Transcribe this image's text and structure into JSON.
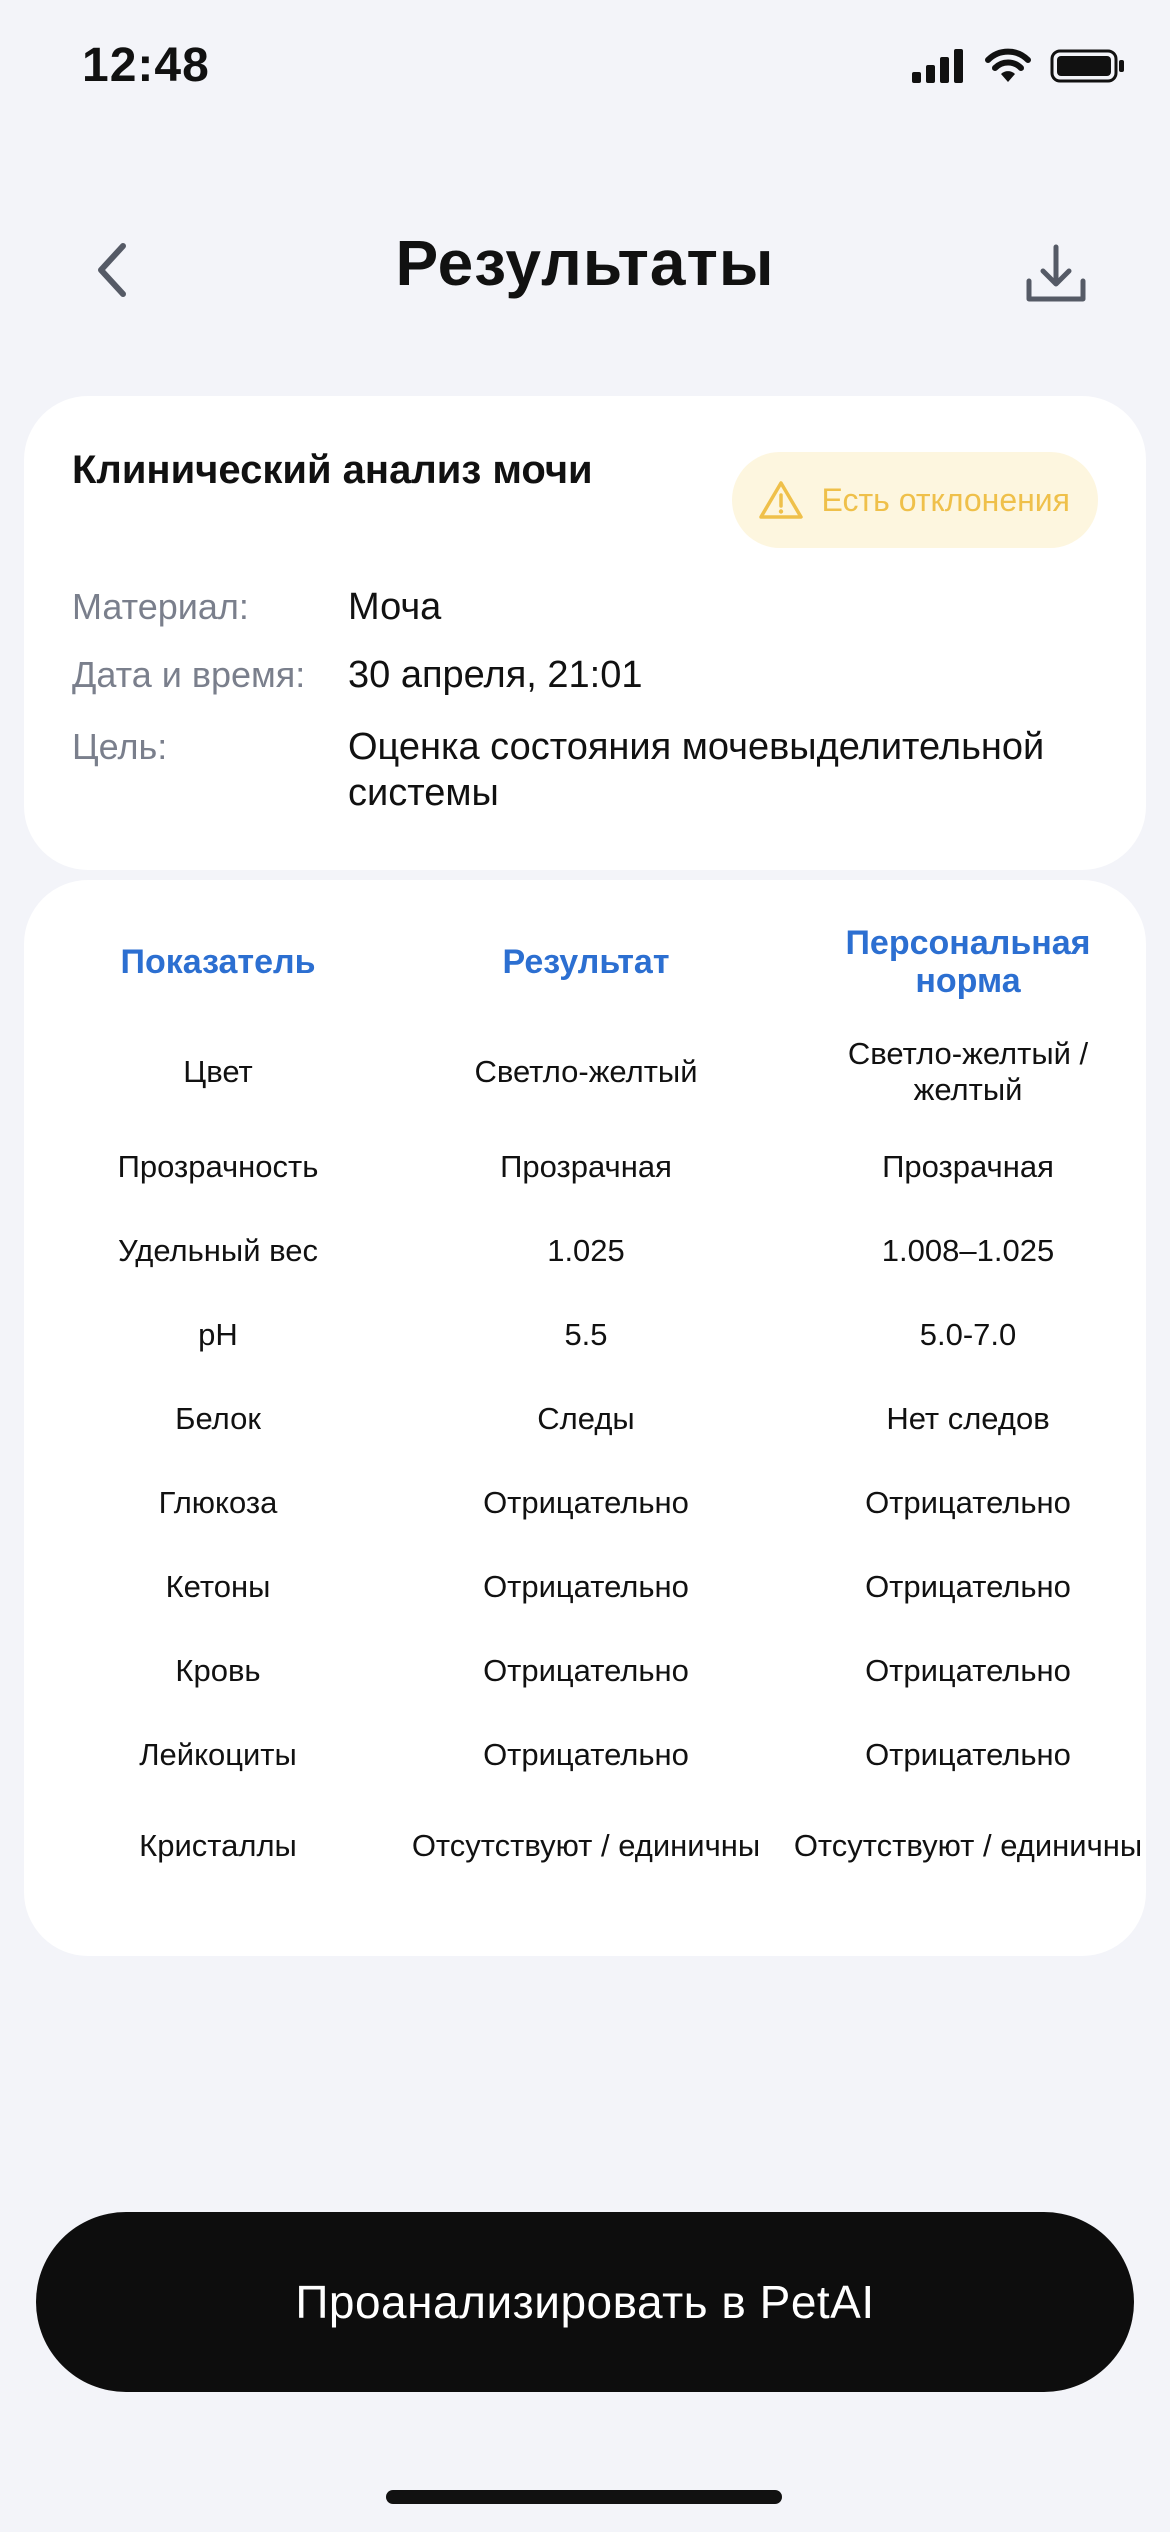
{
  "status_bar": {
    "time": "12:48",
    "icons": [
      "signal-icon",
      "wifi-icon",
      "battery-icon"
    ]
  },
  "header": {
    "title": "Результаты",
    "back_icon": "chevron-left-icon",
    "download_icon": "download-icon"
  },
  "info": {
    "test_name": "Клинический анализ мочи",
    "badge": {
      "label": "Есть отклонения",
      "icon": "warning-icon",
      "color": "#efc04a",
      "background": "#fdf6df"
    },
    "rows": [
      {
        "label": "Материал:",
        "value": "Моча"
      },
      {
        "label": "Дата и время:",
        "value": "30 апреля, 21:01"
      },
      {
        "label": "Цель:",
        "value": "Оценка состояния мочевыделительной системы"
      }
    ]
  },
  "table": {
    "headers": [
      "Показатель",
      "Результат",
      "Персональная норма"
    ],
    "rows": [
      [
        "Цвет",
        "Светло-желтый",
        "Светло-желтый / желтый"
      ],
      [
        "Прозрачность",
        "Прозрачная",
        "Прозрачная"
      ],
      [
        "Удельный вес",
        "1.025",
        "1.008–1.025"
      ],
      [
        "pH",
        "5.5",
        "5.0-7.0"
      ],
      [
        "Белок",
        "Следы",
        "Нет следов"
      ],
      [
        "Глюкоза",
        "Отрицательно",
        "Отрицательно"
      ],
      [
        "Кетоны",
        "Отрицательно",
        "Отрицательно"
      ],
      [
        "Кровь",
        "Отрицательно",
        "Отрицательно"
      ],
      [
        "Лейкоциты",
        "Отрицательно",
        "Отрицательно"
      ],
      [
        "Кристаллы",
        "Отсутствуют / единичны",
        "Отсутствуют / единичны"
      ]
    ]
  },
  "action": {
    "label": "Проанализировать в PetAI"
  },
  "colors": {
    "background": "#f3f4f9",
    "accent_blue": "#2c6fd1",
    "button": "#0d0d0d"
  }
}
